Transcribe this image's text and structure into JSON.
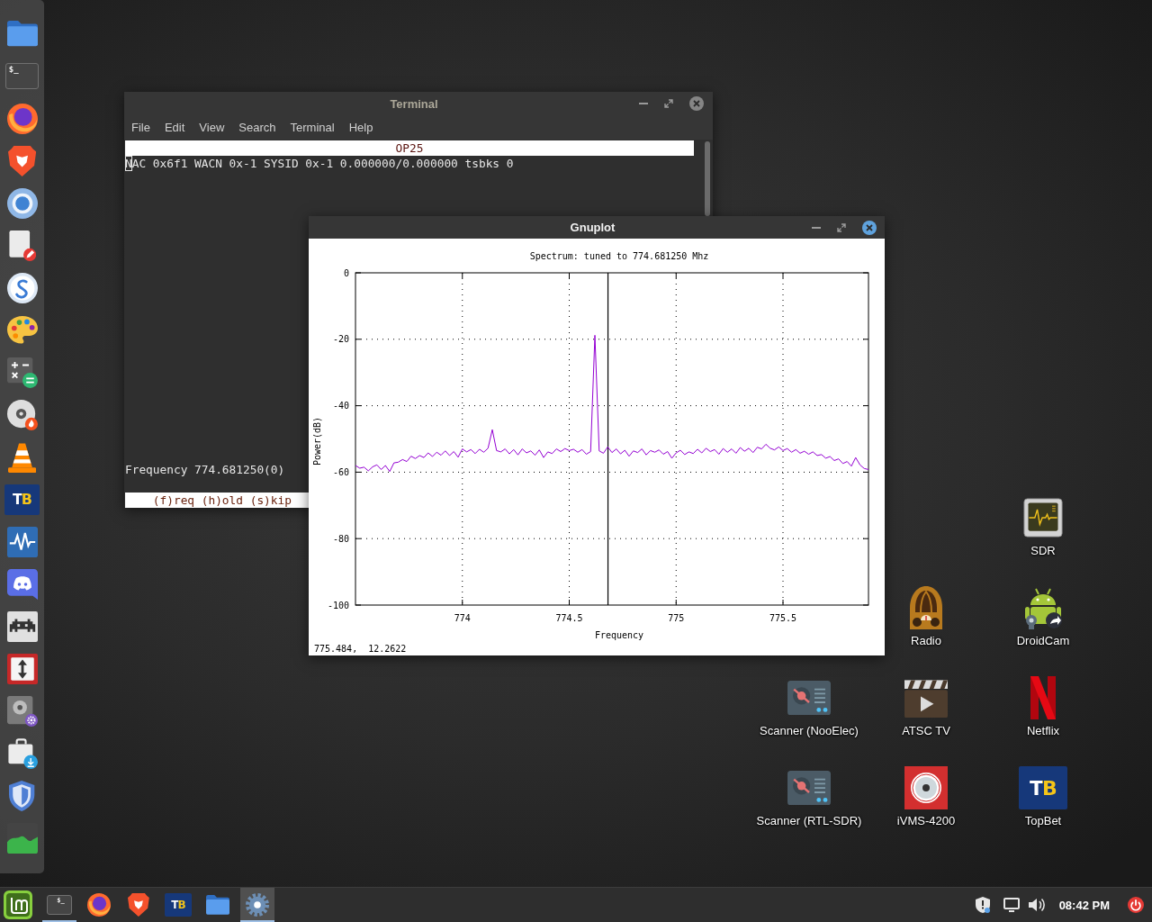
{
  "dock": {
    "items": [
      {
        "kind": "folder"
      },
      {
        "kind": "terminal",
        "glyph": "$_"
      },
      {
        "kind": "fox"
      },
      {
        "kind": "lion"
      },
      {
        "kind": "ring"
      },
      {
        "kind": "editor"
      },
      {
        "kind": "swirl"
      },
      {
        "kind": "palette"
      },
      {
        "kind": "calculator"
      },
      {
        "kind": "disc"
      },
      {
        "kind": "cone"
      },
      {
        "kind": "tb",
        "glyph": "TB"
      },
      {
        "kind": "waveform"
      },
      {
        "kind": "chat"
      },
      {
        "kind": "invader"
      },
      {
        "kind": "updown"
      },
      {
        "kind": "diskgear"
      },
      {
        "kind": "package"
      },
      {
        "kind": "shield"
      },
      {
        "kind": "chart"
      }
    ]
  },
  "terminal_window": {
    "title": "Terminal",
    "focused": false,
    "menu": [
      "File",
      "Edit",
      "View",
      "Search",
      "Terminal",
      "Help"
    ],
    "header": "OP25",
    "lines": [
      "NAC 0x6f1 WACN 0x-1 SYSID 0x-1 0.000000/0.000000 tsbks 0"
    ],
    "frequency_line": "Frequency 774.681250(0)",
    "prompt": "(f)req (h)old (s)kip"
  },
  "gnuplot_window": {
    "title": "Gnuplot",
    "focused": true,
    "chart_data": {
      "type": "line",
      "title": "Spectrum: tuned to 774.681250 Mhz",
      "xlabel": "Frequency",
      "ylabel": "Power(dB)",
      "x": [
        773.5,
        773.52,
        773.54,
        773.56,
        773.58,
        773.6,
        773.62,
        773.64,
        773.66,
        773.68,
        773.7,
        773.72,
        773.74,
        773.76,
        773.78,
        773.8,
        773.82,
        773.84,
        773.86,
        773.88,
        773.9,
        773.92,
        773.94,
        773.96,
        773.98,
        774,
        774.02,
        774.04,
        774.06,
        774.08,
        774.1,
        774.12,
        774.14,
        774.16,
        774.18,
        774.2,
        774.22,
        774.24,
        774.26,
        774.28,
        774.3,
        774.32,
        774.34,
        774.36,
        774.38,
        774.4,
        774.42,
        774.44,
        774.46,
        774.48,
        774.5,
        774.52,
        774.54,
        774.56,
        774.58,
        774.6,
        774.62,
        774.64,
        774.66,
        774.68,
        774.7,
        774.72,
        774.74,
        774.76,
        774.78,
        774.8,
        774.82,
        774.84,
        774.86,
        774.88,
        774.9,
        774.92,
        774.94,
        774.96,
        774.98,
        775,
        775.02,
        775.04,
        775.06,
        775.08,
        775.1,
        775.12,
        775.14,
        775.16,
        775.18,
        775.2,
        775.22,
        775.24,
        775.26,
        775.28,
        775.3,
        775.32,
        775.34,
        775.36,
        775.38,
        775.4,
        775.42,
        775.44,
        775.46,
        775.48,
        775.5,
        775.52,
        775.54,
        775.56,
        775.58,
        775.6,
        775.62,
        775.64,
        775.66,
        775.68,
        775.7,
        775.72,
        775.74,
        775.76,
        775.78,
        775.8,
        775.82,
        775.84,
        775.86,
        775.88,
        775.9
      ],
      "series": [
        {
          "color": "#9400d3",
          "values": [
            -58.0,
            -58.8,
            -58.5,
            -59.6,
            -58.4,
            -57.8,
            -59.2,
            -58.0,
            -59.8,
            -57.2,
            -57.0,
            -56.2,
            -56.8,
            -55.2,
            -55.9,
            -55.0,
            -55.6,
            -54.2,
            -55.3,
            -54.0,
            -54.9,
            -53.6,
            -55.0,
            -53.8,
            -55.5,
            -53.0,
            -53.9,
            -53.2,
            -54.4,
            -53.1,
            -54.0,
            -52.8,
            -47.2,
            -53.5,
            -53.9,
            -53.0,
            -54.5,
            -53.2,
            -54.8,
            -53.0,
            -54.2,
            -53.6,
            -54.9,
            -53.3,
            -55.6,
            -53.9,
            -54.4,
            -53.0,
            -53.8,
            -52.9,
            -53.5,
            -53.1,
            -54.0,
            -53.2,
            -54.6,
            -53.8,
            -18.8,
            -53.6,
            -54.3,
            -52.4,
            -54.1,
            -53.0,
            -54.5,
            -53.4,
            -55.2,
            -53.6,
            -54.1,
            -53.0,
            -54.8,
            -53.5,
            -54.0,
            -53.3,
            -54.6,
            -53.8,
            -55.8,
            -54.2,
            -53.4,
            -54.7,
            -53.9,
            -54.4,
            -53.1,
            -54.2,
            -52.8,
            -53.8,
            -53.2,
            -54.6,
            -52.9,
            -54.0,
            -53.0,
            -54.3,
            -52.6,
            -53.7,
            -52.8,
            -54.1,
            -52.5,
            -53.0,
            -51.6,
            -52.8,
            -53.3,
            -52.4,
            -53.5,
            -52.9,
            -54.0,
            -53.2,
            -54.3,
            -53.7,
            -54.6,
            -53.9,
            -55.0,
            -54.7,
            -55.8,
            -55.3,
            -56.5,
            -56.0,
            -57.4,
            -56.8,
            -58.2,
            -55.6,
            -57.8,
            -58.9,
            -59.2
          ]
        }
      ],
      "xlim": [
        773.5,
        775.9
      ],
      "ylim": [
        -100,
        0
      ],
      "xticks": [
        774,
        774.5,
        775,
        775.5
      ],
      "yticks": [
        -100,
        -80,
        -60,
        -40,
        -20,
        0
      ],
      "grid": true,
      "ref_lines": [
        {
          "axis": "x",
          "value": 774.68125
        }
      ]
    },
    "status": "775.484,  12.2622"
  },
  "desktop_icons": [
    {
      "label": "SDR",
      "kind": "scope"
    },
    {
      "label": "Radio",
      "kind": "radio"
    },
    {
      "label": "DroidCam",
      "kind": "android"
    },
    {
      "label": "Scanner (NooElec)",
      "kind": "scanner"
    },
    {
      "label": "ATSC TV",
      "kind": "clapper"
    },
    {
      "label": "Netflix",
      "kind": "ribbon"
    },
    {
      "label": "Scanner (RTL-SDR)",
      "kind": "scanner"
    },
    {
      "label": "iVMS-4200",
      "kind": "lens"
    },
    {
      "label": "TopBet",
      "kind": "tb",
      "glyph": "TB"
    }
  ],
  "taskbar": {
    "items": [
      {
        "kind": "terminal",
        "glyph": "$_",
        "running": true,
        "selected": false
      },
      {
        "kind": "fox",
        "running": false,
        "selected": false
      },
      {
        "kind": "lion",
        "running": false,
        "selected": false
      },
      {
        "kind": "tb",
        "glyph": "TB",
        "running": false,
        "selected": false
      },
      {
        "kind": "folder",
        "running": false,
        "selected": false
      },
      {
        "kind": "gear",
        "running": true,
        "selected": true
      }
    ],
    "clock": "08:42 PM"
  }
}
